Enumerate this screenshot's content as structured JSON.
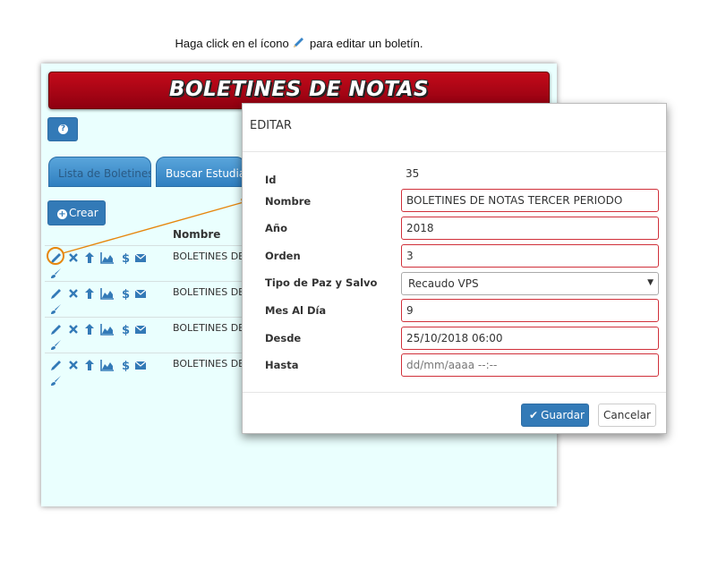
{
  "instruction": {
    "before": "Haga click en el ícono",
    "after": "para editar un boletín."
  },
  "banner": {
    "title": "BOLETINES DE NOTAS"
  },
  "help_button": {
    "icon": "question-circle-icon"
  },
  "tabs": [
    {
      "label": "Lista de Boletines"
    },
    {
      "label": "Buscar Estudiantes"
    }
  ],
  "create_button": {
    "label": "Crear"
  },
  "table": {
    "column_name": "Nombre",
    "rows": [
      {
        "name": "BOLETINES DE"
      },
      {
        "name": "BOLETINES DE"
      },
      {
        "name": "BOLETINES DE"
      },
      {
        "name": "BOLETINES DE"
      }
    ],
    "row_icons": [
      "pencil-icon",
      "times-icon",
      "arrow-up-icon",
      "area-chart-icon",
      "dollar-icon",
      "envelope-icon",
      "paint-brush-icon"
    ]
  },
  "modal": {
    "title": "EDITAR",
    "fields": {
      "id_label": "Id",
      "id_value": "35",
      "nombre_label": "Nombre",
      "nombre_value": "BOLETINES DE NOTAS TERCER PERIODO",
      "anio_label": "Año",
      "anio_value": "2018",
      "orden_label": "Orden",
      "orden_value": "3",
      "tipo_label": "Tipo de Paz y Salvo",
      "tipo_value": "Recaudo VPS",
      "mes_label": "Mes Al Día",
      "mes_value": "9",
      "desde_label": "Desde",
      "desde_value": "25/10/2018 06:00",
      "hasta_label": "Hasta",
      "hasta_placeholder": "dd/mm/aaaa --:--"
    },
    "save_label": "Guardar",
    "cancel_label": "Cancelar"
  },
  "colors": {
    "primary": "#337ab7",
    "banner_red": "#b00014",
    "highlight": "#e6860d",
    "panel_bg": "#eafffe",
    "invalid_border": "#d0303a"
  }
}
